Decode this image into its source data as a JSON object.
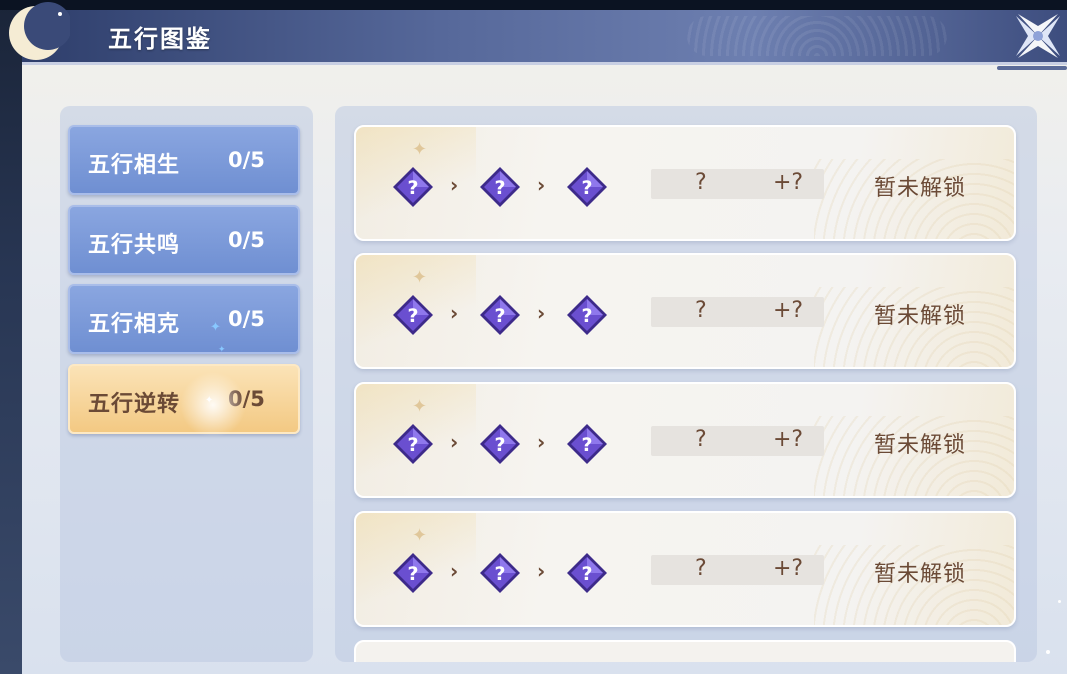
{
  "window": {
    "title": "五行图鉴"
  },
  "tabs": [
    {
      "label": "五行相生",
      "count": "0/5",
      "active": false
    },
    {
      "label": "五行共鸣",
      "count": "0/5",
      "active": false
    },
    {
      "label": "五行相克",
      "count": "0/5",
      "active": false
    },
    {
      "label": "五行逆转",
      "count": "0/5",
      "active": true
    }
  ],
  "entries": [
    {
      "element1": "?",
      "element2": "?",
      "element3": "?",
      "value": "?",
      "bonus": "+?",
      "status": "暂未解锁"
    },
    {
      "element1": "?",
      "element2": "?",
      "element3": "?",
      "value": "?",
      "bonus": "+?",
      "status": "暂未解锁"
    },
    {
      "element1": "?",
      "element2": "?",
      "element3": "?",
      "value": "?",
      "bonus": "+?",
      "status": "暂未解锁"
    },
    {
      "element1": "?",
      "element2": "?",
      "element3": "?",
      "value": "?",
      "bonus": "+?",
      "status": "暂未解锁"
    }
  ],
  "icons": {
    "close": "close-icon",
    "unknown_element": "unknown-element-gem-icon",
    "arrow": "chevron-right-icon",
    "moon": "crescent-moon-icon"
  },
  "colors": {
    "tab_inactive": "#7b98d8",
    "tab_active": "#f6d49a",
    "text_brown": "#6b4a36",
    "gem_purple": "#6a4fd0",
    "header": "#56689a"
  }
}
